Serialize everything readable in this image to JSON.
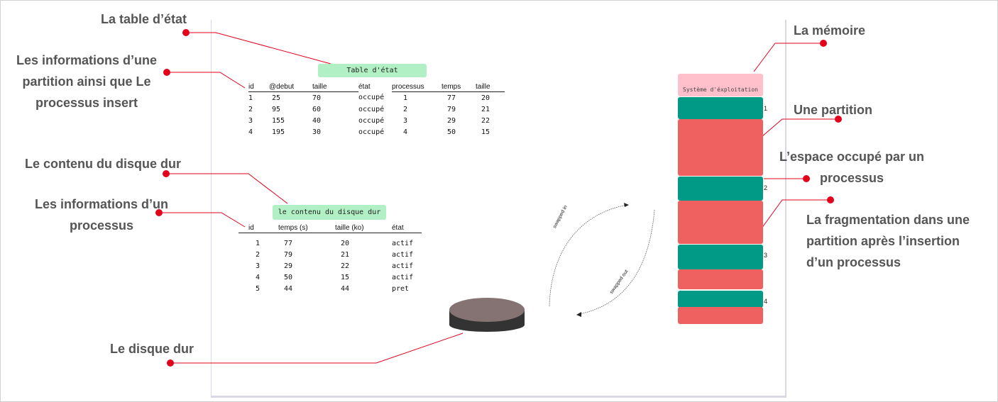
{
  "annotations": {
    "table_etat": "La table d’état",
    "partition_info_l1": "Les informations d’une",
    "partition_info_l2": "partition ainsi que Le",
    "partition_info_l3": "processus insert",
    "disque_contenu": "Le contenu du disque dur",
    "processus_info_l1": "Les informations d’un",
    "processus_info_l2": "processus",
    "disque_dur": "Le disque dur",
    "memoire": "La mémoire",
    "partition": "Une partition",
    "espace_l1": "L’espace occupé par un",
    "espace_l2": "processus",
    "frag_l1": "La fragmentation dans une",
    "frag_l2": "partition après l’insertion",
    "frag_l3": "d’un processus"
  },
  "state_table": {
    "title": "Table d'état",
    "headers": [
      "id",
      "@debut",
      "taille",
      "état",
      "processus",
      "temps",
      "taille"
    ],
    "rows": [
      [
        "1",
        "25",
        "70",
        "occupé",
        "1",
        "77",
        "20"
      ],
      [
        "2",
        "95",
        "60",
        "occupé",
        "2",
        "79",
        "21"
      ],
      [
        "3",
        "155",
        "40",
        "occupé",
        "3",
        "29",
        "22"
      ],
      [
        "4",
        "195",
        "30",
        "occupé",
        "4",
        "50",
        "15"
      ]
    ]
  },
  "disk_table": {
    "title": "le contenu du disque dur",
    "headers": [
      "id",
      "temps (s)",
      "taille (ko)",
      "état"
    ],
    "rows": [
      [
        "1",
        "77",
        "20",
        "actif"
      ],
      [
        "2",
        "79",
        "21",
        "actif"
      ],
      [
        "3",
        "29",
        "22",
        "actif"
      ],
      [
        "4",
        "50",
        "15",
        "actif"
      ],
      [
        "5",
        "44",
        "44",
        "pret"
      ]
    ]
  },
  "memory": {
    "os_label": "Système d'éxploitation",
    "partition_numbers": [
      "1",
      "2",
      "3",
      "4"
    ]
  },
  "swap": {
    "in_label": "swapped in",
    "out_label": "swapped out"
  },
  "colors": {
    "partition_free": "#009a87",
    "process": "#ef6161",
    "os": "#ffc0cb",
    "table_title": "#b1f0c4",
    "annotation_dot": "#e3001b",
    "disk_top": "#857272",
    "disk_side": "#333333"
  }
}
